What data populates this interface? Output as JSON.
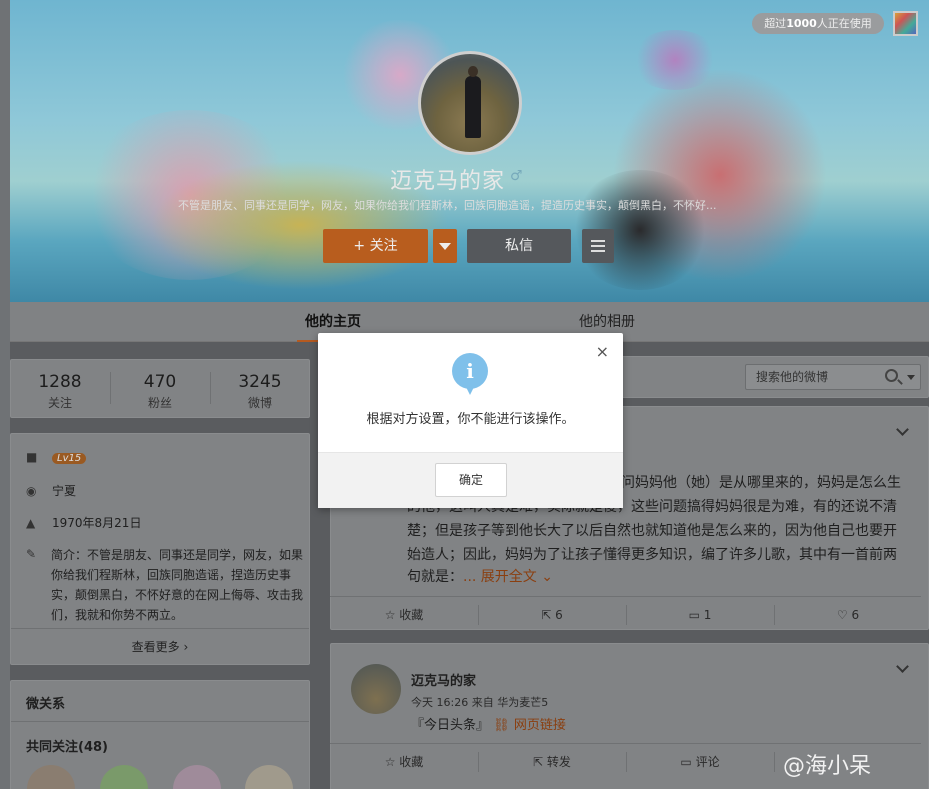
{
  "banner": {
    "online_chip_pre": "超过",
    "online_chip_num": "1000",
    "online_chip_post": "人正在使用"
  },
  "profile": {
    "name": "迈克马的家",
    "bio": "不管是朋友、同事还是同学，网友，如果你给我们程斯林，回族同胞造谣，提造历史事实，颠倒黑白，不怀好...",
    "follow_label": "+ 关注",
    "message_label": "私信"
  },
  "tabs": [
    {
      "label": "他的主页",
      "active": true
    },
    {
      "label": "他的相册",
      "active": false
    }
  ],
  "stats": [
    {
      "value": "1288",
      "label": "关注"
    },
    {
      "value": "470",
      "label": "粉丝"
    },
    {
      "value": "3245",
      "label": "微博"
    }
  ],
  "info": {
    "level": "Lv15",
    "location": "宁夏",
    "birthday": "1970年8月21日",
    "intro": "简介：不管是朋友、同事还是同学，网友，如果你给我们程斯林，回族同胞造谣，捏造历史事实，颠倒黑白，不怀好意的在网上侮辱、攻击我们，我就和你势不两立。",
    "more": "查看更多"
  },
  "relations": {
    "title": "微关系",
    "common_title": "共同关注(48)"
  },
  "search": {
    "placeholder": "搜索他的微博"
  },
  "post1": {
    "line1": "问妈妈他（她）是从哪里来的，妈妈是怎么生",
    "line2": "的他，这叫人真是难，实际就是傻，这些问题搞得妈妈很是为难，有的还说不清",
    "line3": "楚；但是孩子等到他长大了以后自然也就知道他是怎么来的，因为他自己也要开",
    "line4": "始造人；因此，妈妈为了让孩子懂得更多知识，编了许多儿歌，其中有一首前两",
    "line5": "句就是：",
    "expand": "... 展开全文",
    "actions": [
      {
        "icon": "star-icon",
        "label": "收藏"
      },
      {
        "icon": "share-icon",
        "label": "6"
      },
      {
        "icon": "comment-icon",
        "label": "1"
      },
      {
        "icon": "like-icon",
        "label": "6"
      }
    ]
  },
  "post2": {
    "author": "迈克马的家",
    "meta": "今天 16:26 来自 华为麦芒5",
    "text": "『今日头条』",
    "link": "网页链接",
    "actions": [
      {
        "icon": "star-icon",
        "label": "收藏"
      },
      {
        "icon": "share-icon",
        "label": "转发"
      },
      {
        "icon": "comment-icon",
        "label": "评论"
      }
    ]
  },
  "modal": {
    "message": "根据对方设置，你不能进行该操作。",
    "ok_label": "确定",
    "close": "×",
    "info_glyph": "i"
  },
  "watermark": "@海小呆",
  "colors": {
    "follow": "#b85d1e",
    "info": "#7fc0ea",
    "overlay_dim": "#5a5c5f"
  }
}
